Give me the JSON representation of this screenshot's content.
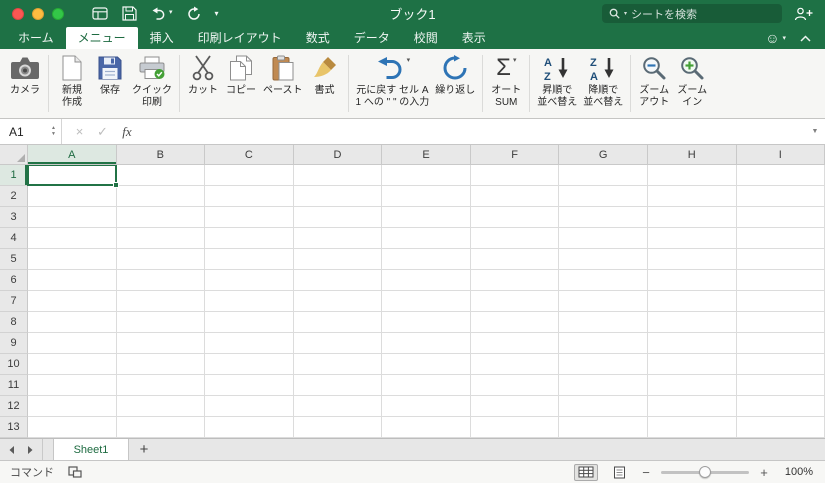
{
  "titlebar": {
    "title": "ブック1",
    "search_placeholder": "シートを検索"
  },
  "ribbon_tabs": [
    {
      "label": "ホーム",
      "active": false
    },
    {
      "label": "メニュー",
      "active": true
    },
    {
      "label": "挿入",
      "active": false
    },
    {
      "label": "印刷レイアウト",
      "active": false
    },
    {
      "label": "数式",
      "active": false
    },
    {
      "label": "データ",
      "active": false
    },
    {
      "label": "校閲",
      "active": false
    },
    {
      "label": "表示",
      "active": false
    }
  ],
  "ribbon_buttons": [
    {
      "id": "camera",
      "label": "カメラ"
    },
    {
      "id": "new",
      "label": "新規\n作成"
    },
    {
      "id": "save",
      "label": "保存"
    },
    {
      "id": "quick-print",
      "label": "クイック\n印刷"
    },
    {
      "id": "cut",
      "label": "カット"
    },
    {
      "id": "copy",
      "label": "コピー"
    },
    {
      "id": "paste",
      "label": "ペースト"
    },
    {
      "id": "format",
      "label": "書式"
    },
    {
      "id": "undo",
      "label": "元に戻す セル A\n1 への \" \" の入力"
    },
    {
      "id": "repeat",
      "label": "繰り返し"
    },
    {
      "id": "autosum",
      "label": "オート\nSUM"
    },
    {
      "id": "sort-asc",
      "label": "昇順で\n並べ替え"
    },
    {
      "id": "sort-desc",
      "label": "降順で\n並べ替え"
    },
    {
      "id": "zoom-out",
      "label": "ズーム\nアウト"
    },
    {
      "id": "zoom-in",
      "label": "ズーム\nイン"
    }
  ],
  "formula_bar": {
    "name_box": "A1",
    "value": ""
  },
  "grid": {
    "columns": [
      "A",
      "B",
      "C",
      "D",
      "E",
      "F",
      "G",
      "H",
      "I"
    ],
    "rows": [
      "1",
      "2",
      "3",
      "4",
      "5",
      "6",
      "7",
      "8",
      "9",
      "10",
      "11",
      "12",
      "13"
    ],
    "selected_column": "A",
    "selected_row": "1",
    "selected_cell": "A1"
  },
  "sheet_bar": {
    "tabs": [
      {
        "label": "Sheet1",
        "active": true
      }
    ],
    "add_button": "+"
  },
  "status_bar": {
    "mode": "コマンド",
    "zoom_level": "100%"
  },
  "icons": {
    "caret_down": "▾",
    "dropdown": "▼",
    "sigma": "Σ",
    "fx": "fx",
    "cancel": "×",
    "check": "✓",
    "smiley": "☺",
    "stepper_up": "▲",
    "stepper_down": "▼",
    "minus": "−",
    "plus": "+",
    "sort_a": "A",
    "sort_z": "Z"
  },
  "colors": {
    "titlebar_green": "#1E7145",
    "accent_green": "#217346",
    "selection_green": "#217346"
  }
}
